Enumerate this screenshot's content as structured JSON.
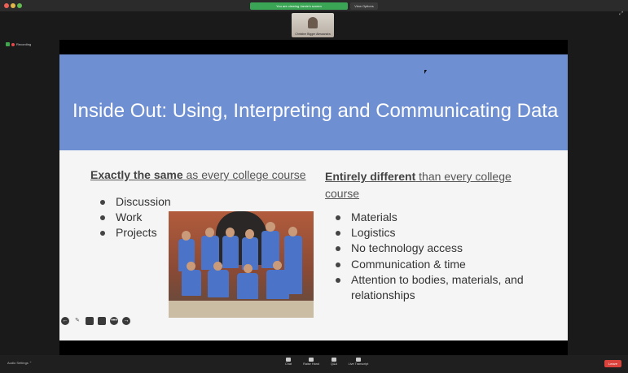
{
  "window": {
    "share_banner": "You are viewing Jamie's screen",
    "view_options": "View Options"
  },
  "camera": {
    "name": "Christine Bigger Alessandra"
  },
  "recording": {
    "label": "Recording"
  },
  "slide": {
    "title": "Inside Out: Using, Interpreting and Communicating Data",
    "left_heading_bold": "Exactly the same",
    "left_heading_rest": " as every college course",
    "left_bullets": [
      "Discussion",
      "Work",
      "Projects"
    ],
    "right_heading_bold": "Entirely different",
    "right_heading_rest": "  than every college course",
    "right_bullets": [
      "Materials",
      "Logistics",
      "No technology access",
      "Communication & time",
      "Attention to bodies, materials, and relationships"
    ]
  },
  "slide_controls": {
    "prev": "←",
    "next": "→"
  },
  "toolbar": {
    "audio_settings": "Audio Settings",
    "chat": "Chat",
    "raise_hand": "Raise Hand",
    "qa": "Q&A",
    "live_transcript": "Live Transcript",
    "leave": "Leave"
  }
}
